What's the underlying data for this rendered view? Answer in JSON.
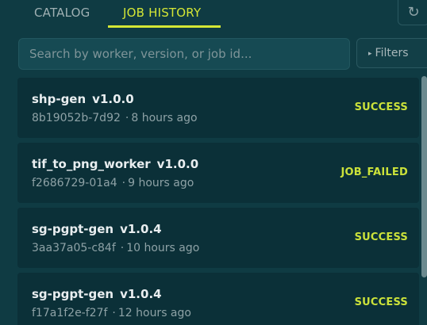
{
  "tabs": {
    "catalog_label": "CATALOG",
    "history_label": "JOB HISTORY",
    "active": "JOB HISTORY"
  },
  "refresh": {
    "icon": "refresh-icon",
    "glyph": "↻"
  },
  "search": {
    "placeholder": "Search by worker, version, or job id...",
    "value": ""
  },
  "filters": {
    "label": "Filters",
    "icon": "triangle-right-icon",
    "glyph": "▸"
  },
  "jobs": [
    {
      "name": "shp-gen",
      "version": "v1.0.0",
      "id": "8b19052b-7d92",
      "time": "8 hours ago",
      "status": "SUCCESS"
    },
    {
      "name": "tif_to_png_worker",
      "version": "v1.0.0",
      "id": "f2686729-01a4",
      "time": "9 hours ago",
      "status": "JOB_FAILED"
    },
    {
      "name": "sg-pgpt-gen",
      "version": "v1.0.4",
      "id": "3aa37a05-c84f",
      "time": "10 hours ago",
      "status": "SUCCESS"
    },
    {
      "name": "sg-pgpt-gen",
      "version": "v1.0.4",
      "id": "f17a1f2e-f27f",
      "time": "12 hours ago",
      "status": "SUCCESS"
    }
  ],
  "meta_separator": "·",
  "colors": {
    "background": "#0f3b43",
    "card": "#0b3038",
    "accent": "#d4e635",
    "status": "#cbe23a"
  }
}
